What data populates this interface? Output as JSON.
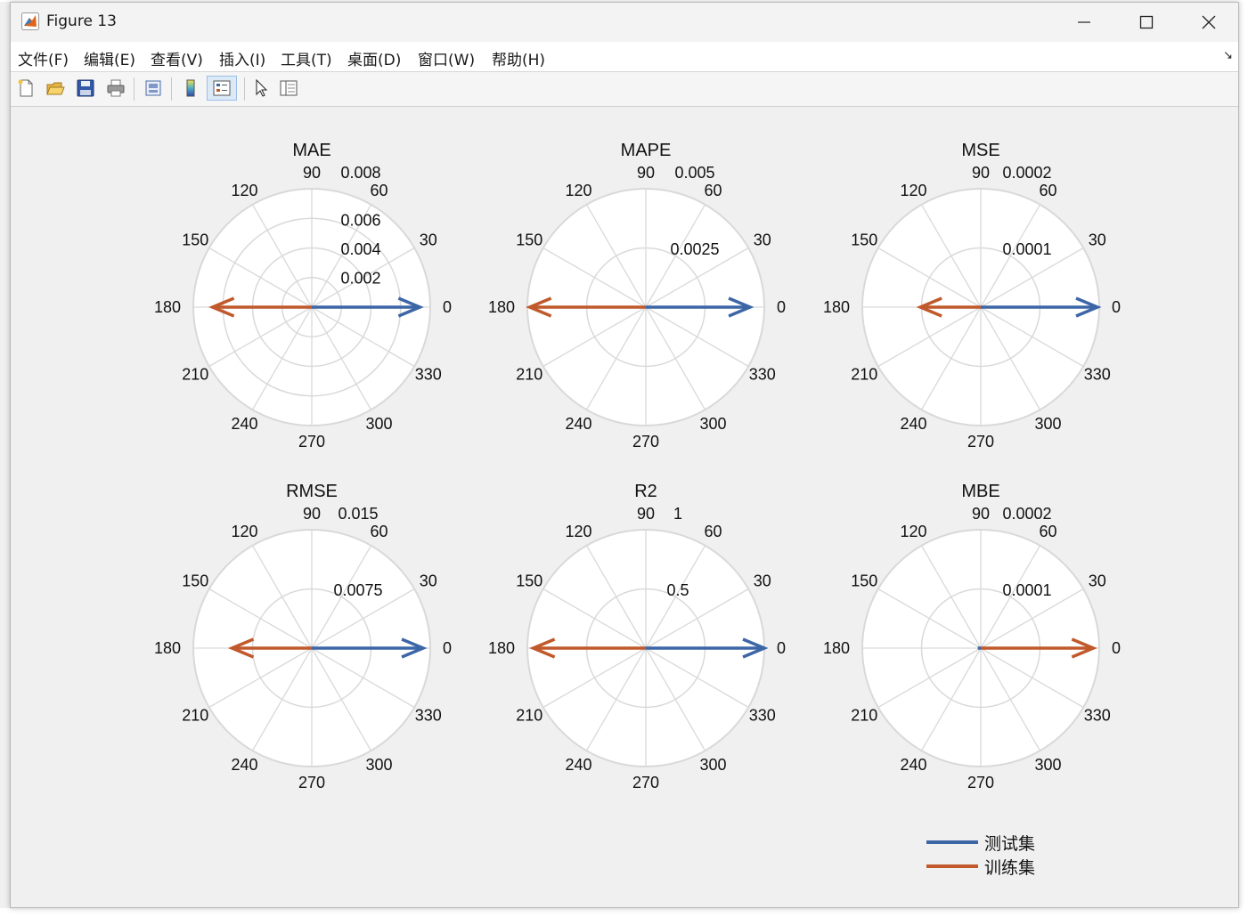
{
  "window": {
    "title": "Figure 13"
  },
  "menu": [
    "文件(F)",
    "编辑(E)",
    "查看(V)",
    "插入(I)",
    "工具(T)",
    "桌面(D)",
    "窗口(W)",
    "帮助(H)"
  ],
  "menu_overflow": "↘",
  "toolbar": [
    "new-figure-icon",
    "open-file-icon",
    "save-icon",
    "print-icon",
    "print-preview-icon",
    "colorbar-icon",
    "legend-icon",
    "pointer-icon",
    "property-inspector-icon"
  ],
  "angle_labels": [
    "0",
    "30",
    "60",
    "90",
    "120",
    "150",
    "180",
    "210",
    "240",
    "270",
    "300",
    "330"
  ],
  "colors": {
    "test": "#3d66a7",
    "train": "#c0592b",
    "grid": "#d9d9d9",
    "polar_bg": "#ffffff"
  },
  "legend": {
    "test": "测试集",
    "train": "训练集"
  },
  "chart_data": [
    {
      "type": "polar-compass",
      "title": "MAE",
      "rmax": 0.008,
      "ticks": [
        "0.002",
        "0.004",
        "0.006",
        "0.008"
      ],
      "tick_values": [
        0.002,
        0.004,
        0.006,
        0.008
      ],
      "series": [
        {
          "name": "测试集",
          "angle": 0,
          "value": 0.0073
        },
        {
          "name": "训练集",
          "angle": 180,
          "value": 0.0067
        }
      ]
    },
    {
      "type": "polar-compass",
      "title": "MAPE",
      "rmax": 0.005,
      "ticks": [
        "0.0025",
        "0.005"
      ],
      "tick_values": [
        0.0025,
        0.005
      ],
      "series": [
        {
          "name": "测试集",
          "angle": 0,
          "value": 0.0044
        },
        {
          "name": "训练集",
          "angle": 180,
          "value": 0.0049
        }
      ]
    },
    {
      "type": "polar-compass",
      "title": "MSE",
      "rmax": 0.0002,
      "ticks": [
        "0.0001",
        "0.0002"
      ],
      "tick_values": [
        0.0001,
        0.0002
      ],
      "series": [
        {
          "name": "测试集",
          "angle": 0,
          "value": 0.000197
        },
        {
          "name": "训练集",
          "angle": 180,
          "value": 0.000102
        }
      ]
    },
    {
      "type": "polar-compass",
      "title": "RMSE",
      "rmax": 0.015,
      "ticks": [
        "0.0075",
        "0.015"
      ],
      "tick_values": [
        0.0075,
        0.015
      ],
      "series": [
        {
          "name": "测试集",
          "angle": 0,
          "value": 0.0141
        },
        {
          "name": "训练集",
          "angle": 180,
          "value": 0.0101
        }
      ]
    },
    {
      "type": "polar-compass",
      "title": "R2",
      "rmax": 1,
      "ticks": [
        "0.5",
        "1"
      ],
      "tick_values": [
        0.5,
        1
      ],
      "series": [
        {
          "name": "测试集",
          "angle": 0,
          "value": 1.0
        },
        {
          "name": "训练集",
          "angle": 180,
          "value": 0.95
        }
      ]
    },
    {
      "type": "polar-compass",
      "title": "MBE",
      "rmax": 0.0002,
      "ticks": [
        "0.0001",
        "0.0002"
      ],
      "tick_values": [
        0.0001,
        0.0002
      ],
      "series": [
        {
          "name": "测试集",
          "angle": 180,
          "value": 5e-06
        },
        {
          "name": "训练集",
          "angle": 0,
          "value": 0.00019
        }
      ]
    }
  ]
}
